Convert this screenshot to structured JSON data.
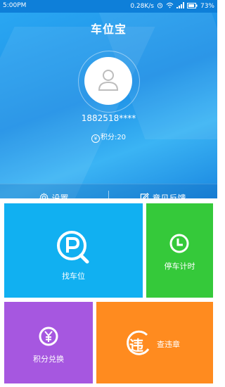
{
  "status": {
    "time": "5:00PM",
    "speed": "0.28K/s",
    "battery": "73%"
  },
  "app": {
    "title": "车位宝"
  },
  "user": {
    "phone": "1882518****",
    "points_label": "积分:20",
    "currency_symbol": "¥"
  },
  "actions": {
    "settings": "设置",
    "feedback": "意见反馈"
  },
  "tiles": {
    "find_spot": "找车位",
    "parking_timer": "停车计时",
    "points_exchange": "积分兑换",
    "violations": "查违章",
    "violation_glyph": "违"
  },
  "icons": {
    "status": [
      "alarm-icon",
      "wifi-icon",
      "signal-icon",
      "battery-icon"
    ],
    "avatar": "user-icon",
    "settings": "gear-icon",
    "feedback": "edit-icon",
    "find_spot": "parking-search-icon",
    "parking_timer": "clock-icon",
    "points_exchange": "yen-icon",
    "violations": "violation-icon"
  },
  "colors": {
    "header": "#1c8fe6",
    "find_spot": "#11b0f1",
    "parking_timer": "#35c93a",
    "points_exchange": "#a657e0",
    "violations": "#ff8b1f"
  }
}
